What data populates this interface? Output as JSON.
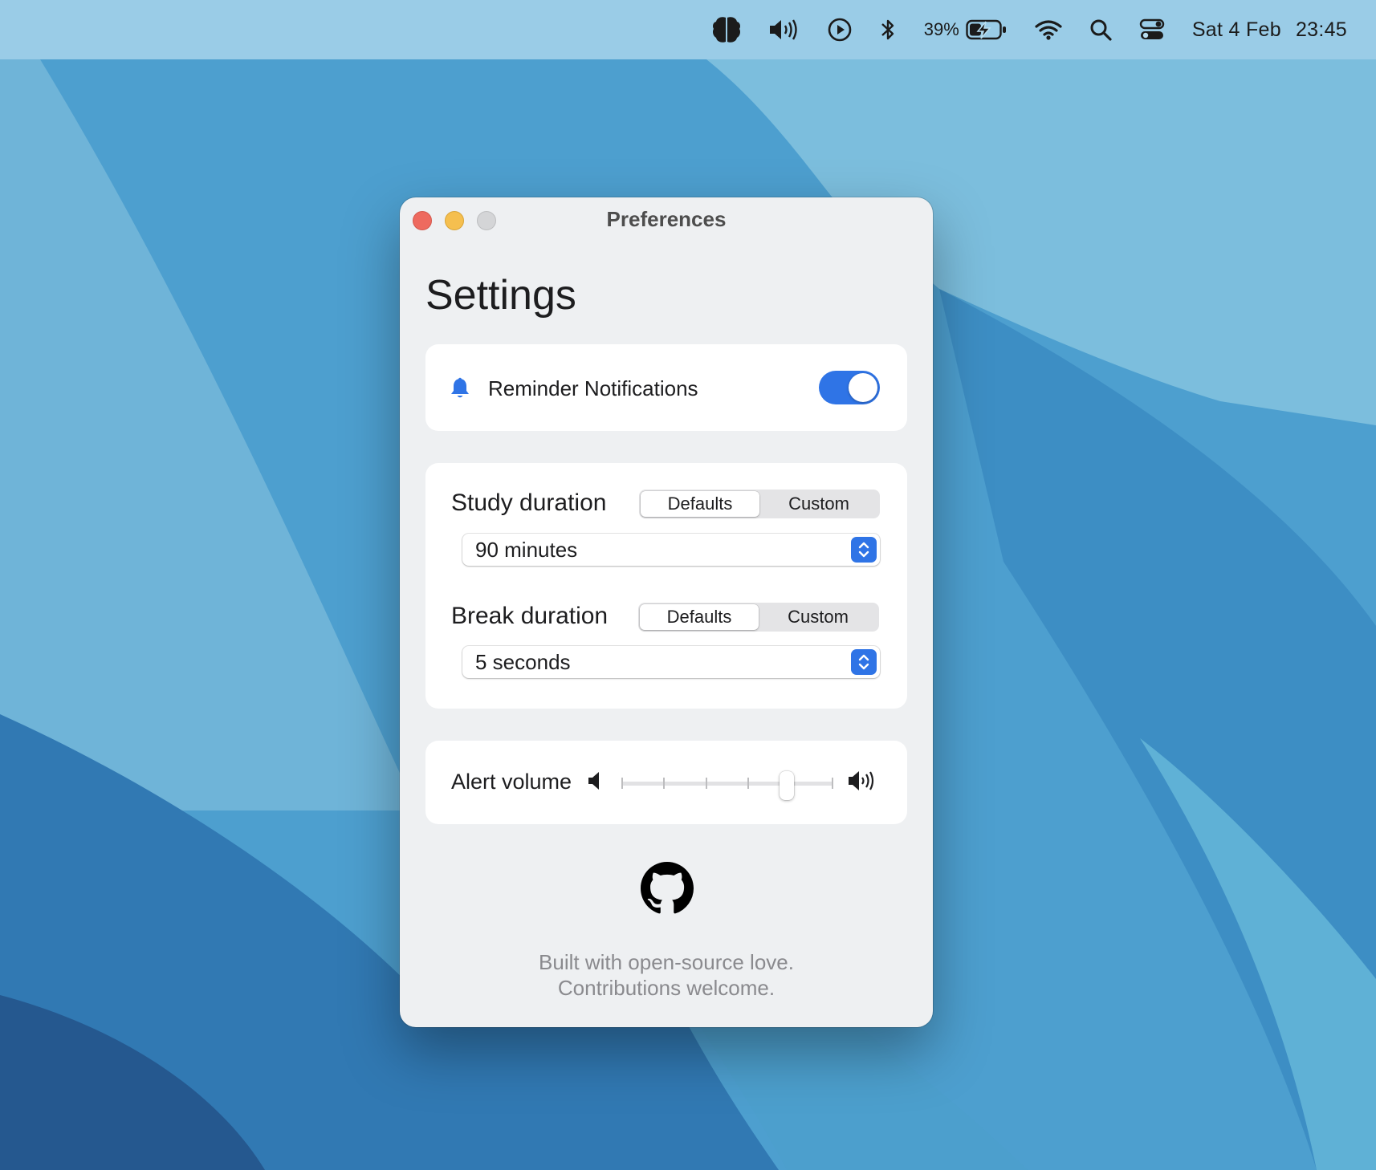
{
  "menubar": {
    "icons": [
      "brain-icon",
      "volume-icon",
      "play-icon",
      "bluetooth-icon",
      "battery-icon",
      "wifi-icon",
      "search-icon",
      "control-center-icon"
    ],
    "battery_percent": "39%",
    "date": "Sat 4 Feb",
    "time": "23:45"
  },
  "window": {
    "title": "Preferences",
    "heading": "Settings"
  },
  "notifications": {
    "label": "Reminder Notifications",
    "icon": "bell-icon",
    "enabled": true
  },
  "study": {
    "label": "Study duration",
    "options": [
      "Defaults",
      "Custom"
    ],
    "selected_option": "Defaults",
    "value": "90 minutes"
  },
  "break": {
    "label": "Break duration",
    "options": [
      "Defaults",
      "Custom"
    ],
    "selected_option": "Defaults",
    "value": "5 seconds"
  },
  "volume": {
    "label": "Alert volume",
    "level_fraction": 0.78,
    "ticks": 6
  },
  "footer": {
    "line1": "Built with open-source love.",
    "line2": "Contributions welcome."
  },
  "colors": {
    "accent": "#2f74e6",
    "window_bg": "#eef0f2",
    "close": "#ee6a5f",
    "minimize": "#f5bf4f",
    "zoom": "#d4d5d7"
  }
}
